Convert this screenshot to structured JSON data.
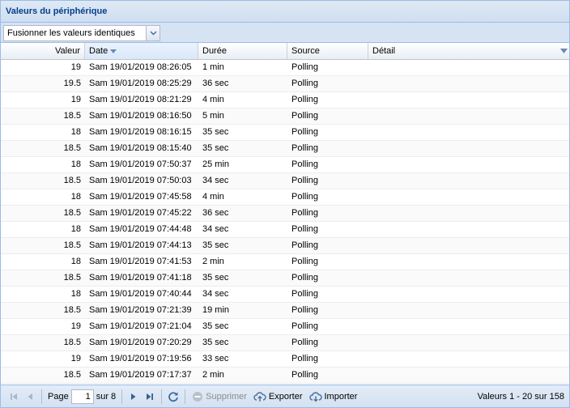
{
  "panel": {
    "title": "Valeurs du périphérique"
  },
  "toolbar": {
    "combo_value": "Fusionner les valeurs identiques"
  },
  "columns": {
    "valeur": "Valeur",
    "date": "Date",
    "duree": "Durée",
    "source": "Source",
    "detail": "Détail"
  },
  "rows": [
    {
      "valeur": "19",
      "date": "Sam 19/01/2019 08:26:05",
      "duree": "1 min",
      "source": "Polling",
      "detail": ""
    },
    {
      "valeur": "19.5",
      "date": "Sam 19/01/2019 08:25:29",
      "duree": "36 sec",
      "source": "Polling",
      "detail": ""
    },
    {
      "valeur": "19",
      "date": "Sam 19/01/2019 08:21:29",
      "duree": "4 min",
      "source": "Polling",
      "detail": ""
    },
    {
      "valeur": "18.5",
      "date": "Sam 19/01/2019 08:16:50",
      "duree": "5 min",
      "source": "Polling",
      "detail": ""
    },
    {
      "valeur": "18",
      "date": "Sam 19/01/2019 08:16:15",
      "duree": "35 sec",
      "source": "Polling",
      "detail": ""
    },
    {
      "valeur": "18.5",
      "date": "Sam 19/01/2019 08:15:40",
      "duree": "35 sec",
      "source": "Polling",
      "detail": ""
    },
    {
      "valeur": "18",
      "date": "Sam 19/01/2019 07:50:37",
      "duree": "25 min",
      "source": "Polling",
      "detail": ""
    },
    {
      "valeur": "18.5",
      "date": "Sam 19/01/2019 07:50:03",
      "duree": "34 sec",
      "source": "Polling",
      "detail": ""
    },
    {
      "valeur": "18",
      "date": "Sam 19/01/2019 07:45:58",
      "duree": "4 min",
      "source": "Polling",
      "detail": ""
    },
    {
      "valeur": "18.5",
      "date": "Sam 19/01/2019 07:45:22",
      "duree": "36 sec",
      "source": "Polling",
      "detail": ""
    },
    {
      "valeur": "18",
      "date": "Sam 19/01/2019 07:44:48",
      "duree": "34 sec",
      "source": "Polling",
      "detail": ""
    },
    {
      "valeur": "18.5",
      "date": "Sam 19/01/2019 07:44:13",
      "duree": "35 sec",
      "source": "Polling",
      "detail": ""
    },
    {
      "valeur": "18",
      "date": "Sam 19/01/2019 07:41:53",
      "duree": "2 min",
      "source": "Polling",
      "detail": ""
    },
    {
      "valeur": "18.5",
      "date": "Sam 19/01/2019 07:41:18",
      "duree": "35 sec",
      "source": "Polling",
      "detail": ""
    },
    {
      "valeur": "18",
      "date": "Sam 19/01/2019 07:40:44",
      "duree": "34 sec",
      "source": "Polling",
      "detail": ""
    },
    {
      "valeur": "18.5",
      "date": "Sam 19/01/2019 07:21:39",
      "duree": "19 min",
      "source": "Polling",
      "detail": ""
    },
    {
      "valeur": "19",
      "date": "Sam 19/01/2019 07:21:04",
      "duree": "35 sec",
      "source": "Polling",
      "detail": ""
    },
    {
      "valeur": "18.5",
      "date": "Sam 19/01/2019 07:20:29",
      "duree": "35 sec",
      "source": "Polling",
      "detail": ""
    },
    {
      "valeur": "19",
      "date": "Sam 19/01/2019 07:19:56",
      "duree": "33 sec",
      "source": "Polling",
      "detail": ""
    },
    {
      "valeur": "18.5",
      "date": "Sam 19/01/2019 07:17:37",
      "duree": "2 min",
      "source": "Polling",
      "detail": ""
    }
  ],
  "pager": {
    "page_label": "Page",
    "page_value": "1",
    "of_label": "sur 8",
    "delete_label": "Supprimer",
    "export_label": "Exporter",
    "import_label": "Importer",
    "info": "Valeurs 1 - 20 sur 158"
  },
  "icons": {
    "first": "first-page-icon",
    "prev": "prev-page-icon",
    "next": "next-page-icon",
    "last": "last-page-icon",
    "refresh": "refresh-icon",
    "delete": "delete-icon",
    "export": "cloud-upload-icon",
    "import": "cloud-download-icon"
  }
}
